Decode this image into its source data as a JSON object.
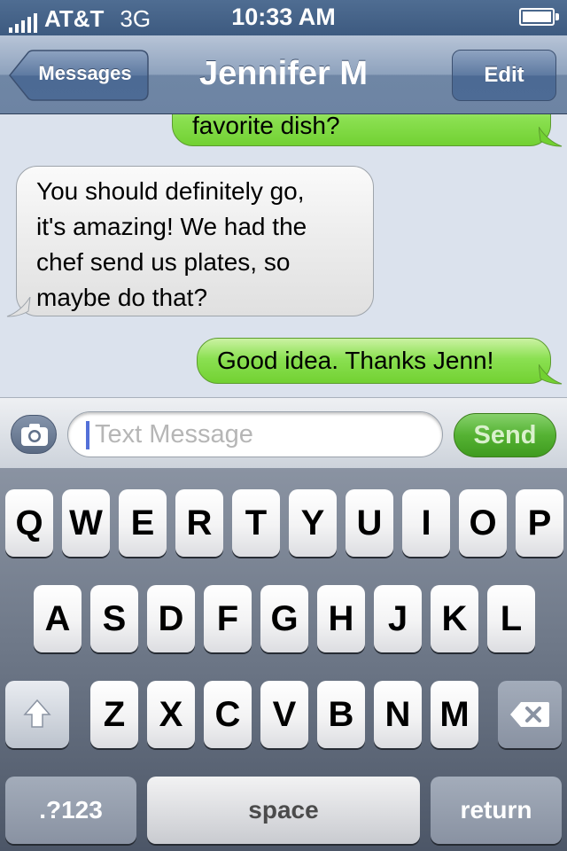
{
  "status_bar": {
    "carrier": "AT&T",
    "network": "3G",
    "time": "10:33 AM",
    "signal_bars": 5,
    "battery_level": 1.0
  },
  "nav": {
    "back_label": "Messages",
    "title": "Jennifer M",
    "edit_label": "Edit"
  },
  "messages": [
    {
      "direction": "outgoing",
      "text": "favorite dish?"
    },
    {
      "direction": "incoming",
      "lines": [
        "You should definitely go,",
        "it's amazing! We had the",
        "chef send us plates, so",
        "maybe do that?"
      ]
    },
    {
      "direction": "outgoing",
      "text": "Good idea. Thanks Jenn!"
    }
  ],
  "composer": {
    "camera_icon": "camera-icon",
    "placeholder": "Text Message",
    "send_label": "Send"
  },
  "keyboard": {
    "row1": [
      "Q",
      "W",
      "E",
      "R",
      "T",
      "Y",
      "U",
      "I",
      "O",
      "P"
    ],
    "row2": [
      "A",
      "S",
      "D",
      "F",
      "G",
      "H",
      "J",
      "K",
      "L"
    ],
    "row3": [
      "Z",
      "X",
      "C",
      "V",
      "B",
      "N",
      "M"
    ],
    "shift_icon": "shift-arrow-icon",
    "delete_icon": "backspace-icon",
    "numbers_label": ".?123",
    "space_label": "space",
    "return_label": "return"
  },
  "colors": {
    "nav_bar": "#6d84a3",
    "outgoing_bubble": "#8be052",
    "incoming_bubble": "#ececec",
    "chat_background": "#dbe2ed",
    "send_button": "#55b233"
  }
}
